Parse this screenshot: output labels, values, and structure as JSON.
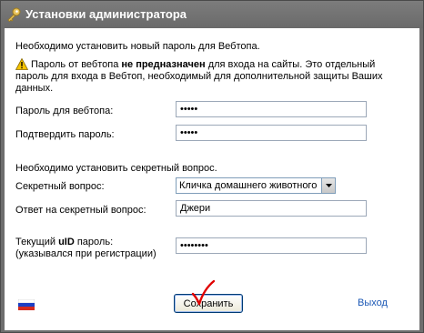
{
  "window": {
    "title": "Установки администратора",
    "icon": "key-icon"
  },
  "form": {
    "password_section_heading": "Необходимо установить новый пароль для Вебтопа.",
    "warning": {
      "icon": "warning-icon",
      "text_before": "Пароль от вебтопа ",
      "text_bold": "не предназначен",
      "text_after": " для входа на сайты. Это отдельный пароль для входа в Вебтоп, необходимый для дополнительной защиты Ваших данных."
    },
    "webtop_password": {
      "label": "Пароль для вебтопа:",
      "value": "•••••"
    },
    "confirm_password": {
      "label": "Подтвердить пароль:",
      "value": "•••••"
    },
    "secret_section_heading": "Необходимо установить секретный вопрос.",
    "secret_question": {
      "label": "Секретный вопрос:",
      "selected": "Кличка домашнего животного"
    },
    "secret_answer": {
      "label": "Ответ на секретный вопрос:",
      "value": "Джери"
    },
    "uid_password": {
      "label_before": "Текущий ",
      "label_bold": "uID",
      "label_after": " пароль:",
      "label_note": "(указывался при регистрации)",
      "value": "••••••••"
    }
  },
  "footer": {
    "language_flag": "russian-flag-icon",
    "save_label": "Сохранить",
    "exit_label": "Выход"
  },
  "colors": {
    "titlebar": "#6e6e6e",
    "link": "#1a57b5",
    "annotation_check": "#e00000"
  }
}
